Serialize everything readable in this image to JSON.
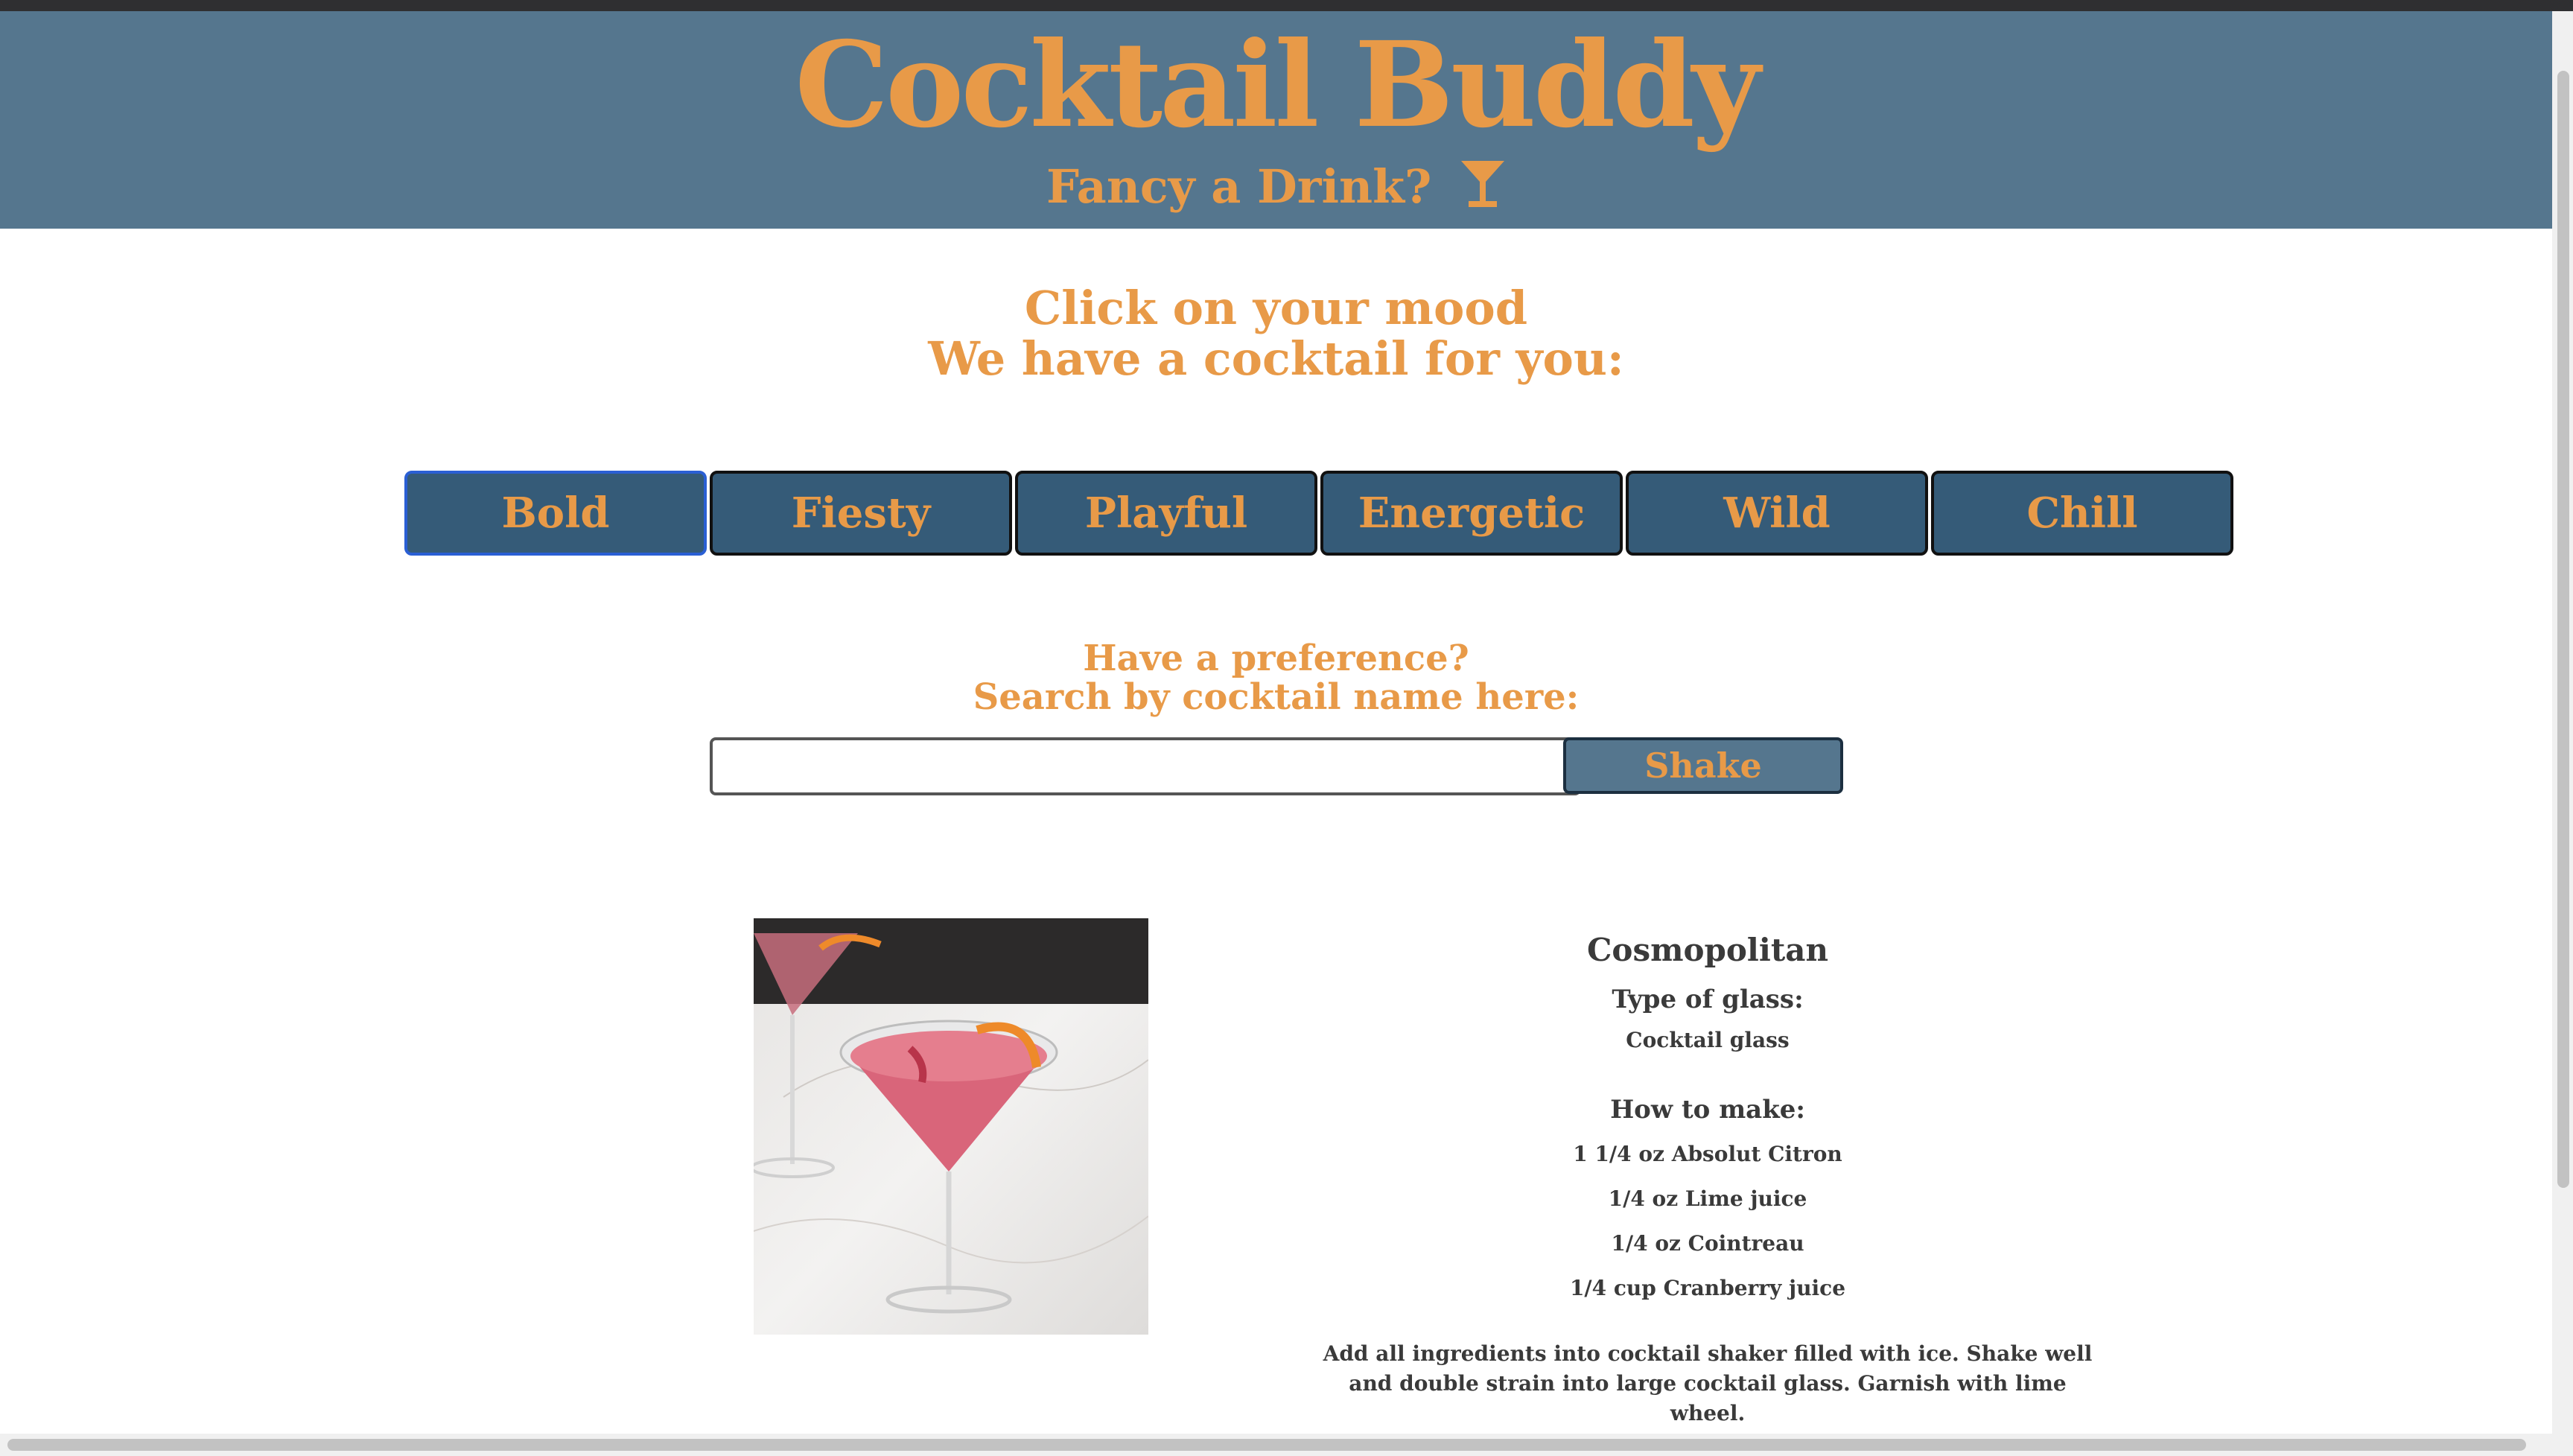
{
  "header": {
    "title": "Cocktail Buddy",
    "tagline": "Fancy a Drink?",
    "tagline_icon": "martini-glass-icon"
  },
  "moods": {
    "heading_line1": "Click on your mood",
    "heading_line2": "We have a cocktail for you:",
    "buttons": [
      "Bold",
      "Fiesty",
      "Playful",
      "Energetic",
      "Wild",
      "Chill"
    ],
    "selected": "Bold"
  },
  "search": {
    "heading_line1": "Have a preference?",
    "heading_line2": "Search by cocktail name here:",
    "value": "",
    "placeholder": "",
    "button_label": "Shake"
  },
  "drink": {
    "name": "Cosmopolitan",
    "glass_label": "Type of glass:",
    "glass": "Cocktail glass",
    "howto_label": "How to make:",
    "ingredients": [
      "1 1/4 oz Absolut Citron",
      "1/4 oz Lime juice",
      "1/4 oz Cointreau",
      "1/4 cup Cranberry juice"
    ],
    "instructions": "Add all ingredients into cocktail shaker filled with ice. Shake well and double strain into large cocktail glass. Garnish with lime wheel."
  },
  "colors": {
    "header_bg": "#55768e",
    "accent": "#e89a48",
    "button_bg": "#355b78",
    "text": "#3a3a3a"
  }
}
